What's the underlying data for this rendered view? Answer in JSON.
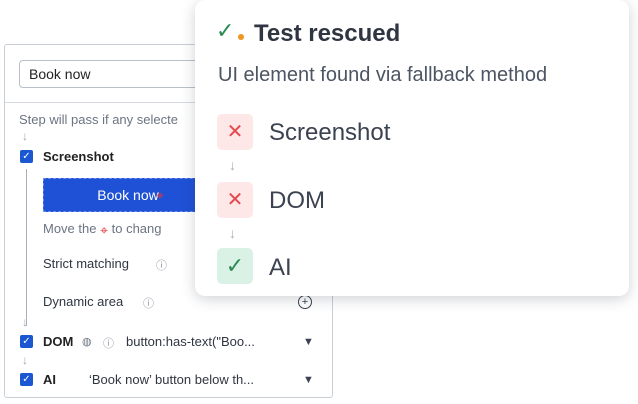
{
  "step_panel": {
    "step_input_value": "Book now",
    "hint_text": "Step will pass if any selecte",
    "screenshot": {
      "label": "Screenshot",
      "checked": true,
      "preview_text": "Book now",
      "move_prefix": "Move the",
      "move_suffix": "to chang",
      "strict_matching_label": "Strict matching",
      "dynamic_area_label": "Dynamic area"
    },
    "dom": {
      "label": "DOM",
      "checked": true,
      "selector_text": "button:has-text(\"Boo..."
    },
    "ai": {
      "label": "AI",
      "checked": true,
      "description_text": "‘Book now’ button below th..."
    }
  },
  "popup": {
    "title": "Test rescued",
    "subtitle": "UI element found via fallback method",
    "methods": [
      {
        "label": "Screenshot",
        "status": "failed"
      },
      {
        "label": "DOM",
        "status": "failed"
      },
      {
        "label": "AI",
        "status": "passed"
      }
    ]
  },
  "colors": {
    "accent_blue": "#1f51d6",
    "fail_red": "#e5484d",
    "success_green": "#2a8a52",
    "orange_dot": "#f0961e"
  }
}
